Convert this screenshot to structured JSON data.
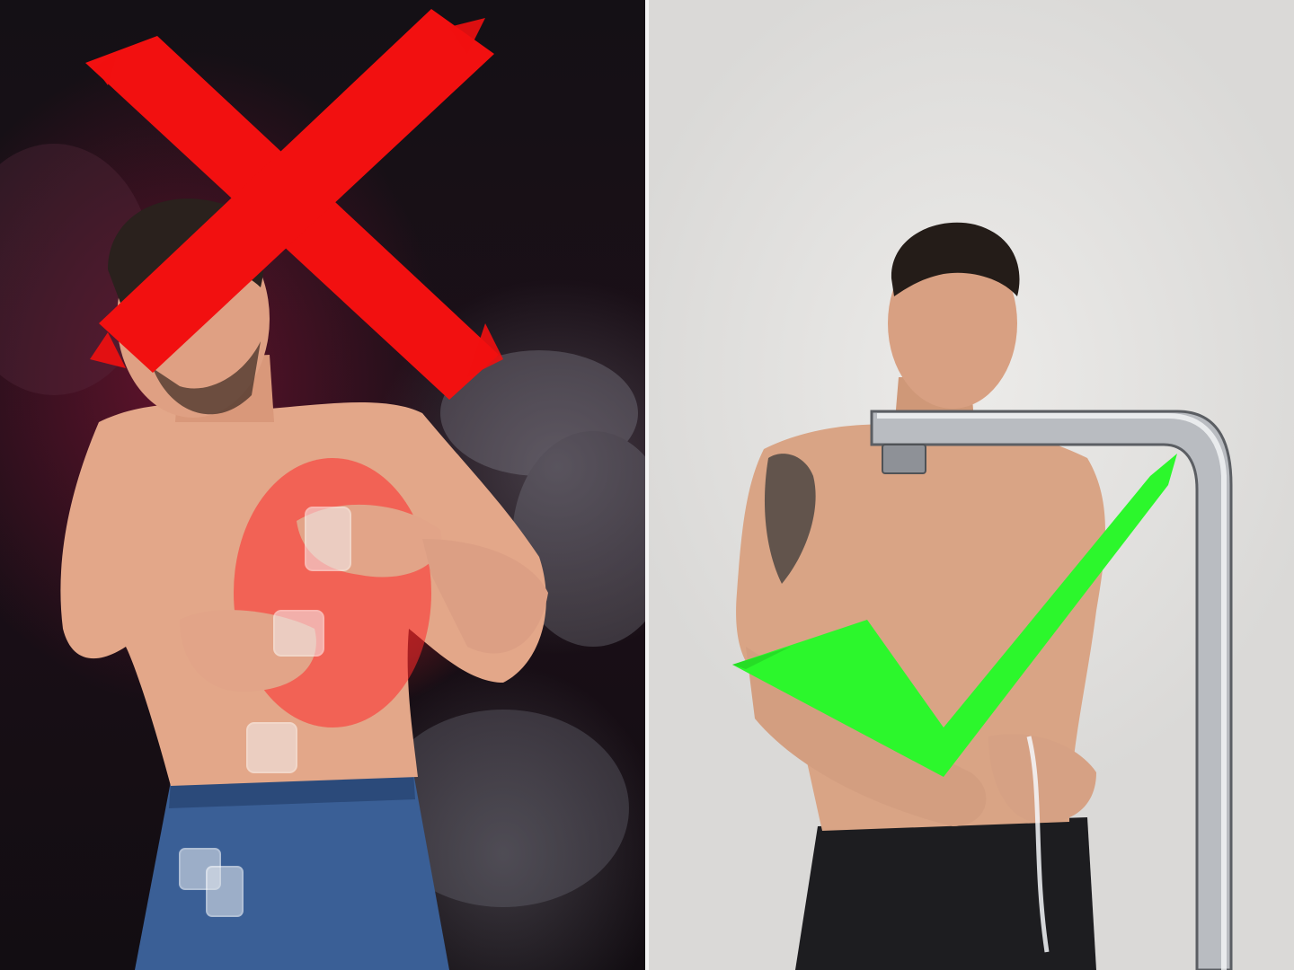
{
  "scene": {
    "left": {
      "subject": "man-clutching-stomach-with-ice-cubes",
      "mark": "red-cross",
      "mark_color": "#f21010"
    },
    "right": {
      "subject": "man-at-chrome-faucet",
      "mark": "green-checkmark",
      "mark_color": "#2cf72c"
    }
  }
}
